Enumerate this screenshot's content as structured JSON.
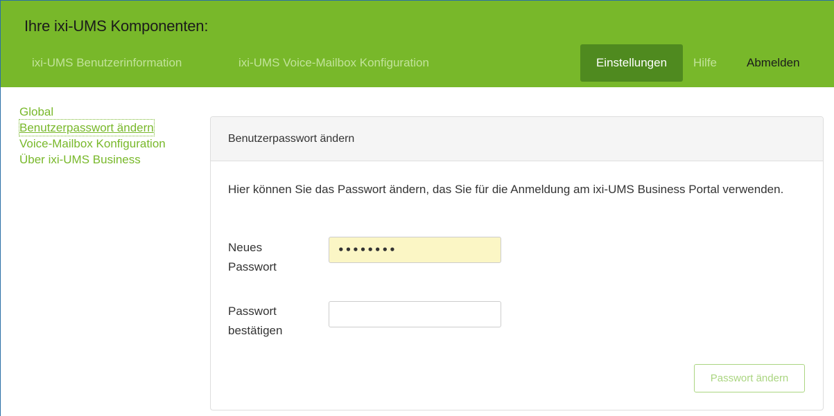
{
  "header": {
    "brand": "Ihre ixi-UMS Komponenten:",
    "nav": {
      "user_info": "ixi-UMS Benutzerinformation",
      "voice_mailbox_config": "ixi-UMS Voice-Mailbox Konfiguration",
      "settings": "Einstellungen",
      "help": "Hilfe",
      "logout": "Abmelden"
    }
  },
  "sidebar": {
    "items": [
      {
        "label": "Global"
      },
      {
        "label": "Benutzerpasswort ändern"
      },
      {
        "label": "Voice-Mailbox Konfiguration"
      },
      {
        "label": "Über ixi-UMS Business"
      }
    ]
  },
  "panel": {
    "heading": "Benutzerpasswort ändern",
    "description": "Hier können Sie das Passwort ändern, das Sie für die Anmeldung am ixi-UMS Business Portal verwenden.",
    "new_password": {
      "label_line1": "Neues",
      "label_line2": "Passwort",
      "value": "••••••••"
    },
    "confirm_password": {
      "label_line1": "Passwort",
      "label_line2": "bestätigen",
      "value": ""
    },
    "submit_label": "Passwort ändern"
  },
  "colors": {
    "accent": "#78b82a",
    "accent_dark": "#4f8a1f",
    "autofill": "#fbf6c5"
  }
}
